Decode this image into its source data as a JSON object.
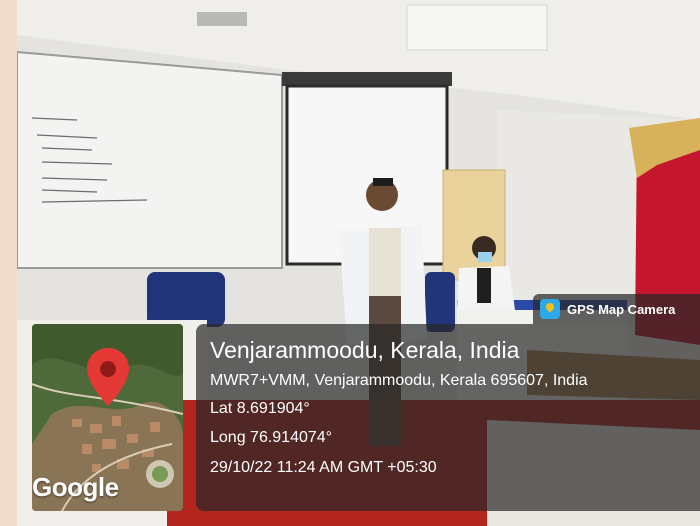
{
  "watermark": {
    "app_name": "GPS Map Camera",
    "app_icon": "gps-map-camera-icon"
  },
  "map": {
    "brand": "Google",
    "pin_icon": "map-pin-icon"
  },
  "location": {
    "place": "Venjarammoodu, Kerala, India",
    "address": "MWR7+VMM, Venjarammoodu, Kerala 695607, India",
    "latitude": "Lat 8.691904°",
    "longitude": "Long 76.914074°",
    "timestamp": "29/10/22 11:24 AM GMT +05:30"
  },
  "colors": {
    "panel_background": "#282828",
    "pin": "#e53935",
    "curtain": "#c4162c",
    "floor": "#b32620"
  }
}
